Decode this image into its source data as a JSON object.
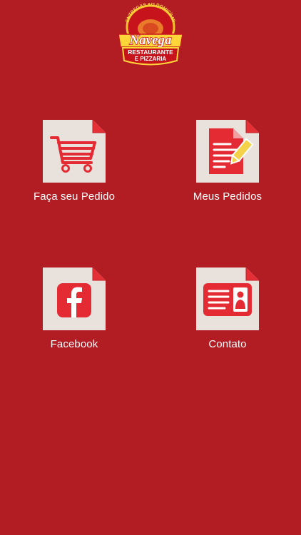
{
  "logo": {
    "arc_text": "ENTREGAS AO DOMICÍLIO",
    "name": "Navega",
    "line1": "RESTAURANTE",
    "line2": "E PIZZARIA"
  },
  "menu": [
    {
      "label": "Faça seu Pedido",
      "icon": "cart-icon"
    },
    {
      "label": "Meus Pedidos",
      "icon": "document-pencil-icon"
    },
    {
      "label": "Facebook",
      "icon": "facebook-icon"
    },
    {
      "label": "Contato",
      "icon": "contact-card-icon"
    }
  ],
  "colors": {
    "background": "#b11d23",
    "tile": "#e8e1dc",
    "icon_red": "#e42b33",
    "corner": "#e52f36"
  }
}
